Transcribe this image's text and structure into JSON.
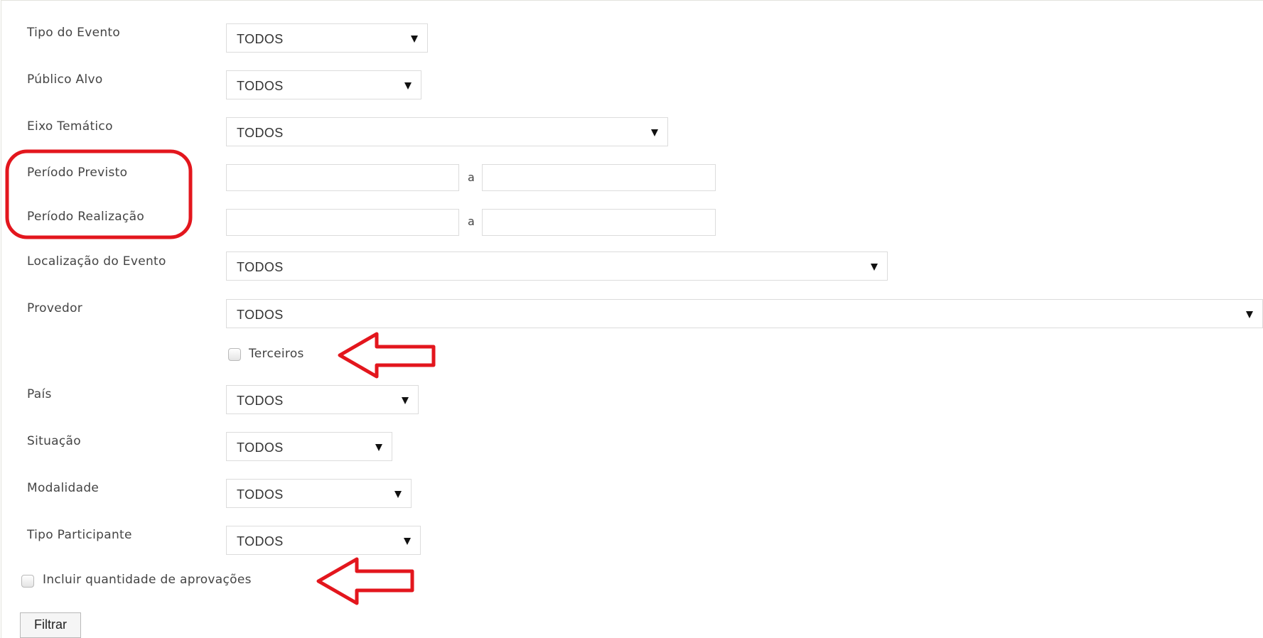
{
  "filters": [
    {
      "id": "tipo-evento",
      "label": "Tipo do Evento",
      "value": "TODOS"
    },
    {
      "id": "publico-alvo",
      "label": "Público Alvo",
      "value": "TODOS"
    },
    {
      "id": "eixo-tematico",
      "label": "Eixo Temático",
      "value": "TODOS"
    },
    {
      "id": "periodo-previsto",
      "label": "Período Previsto",
      "start": "",
      "end": "",
      "separator": "a"
    },
    {
      "id": "periodo-realizacao",
      "label": "Período Realização",
      "start": "",
      "end": "",
      "separator": "a"
    },
    {
      "id": "localizacao",
      "label": "Localização do Evento",
      "value": "TODOS"
    },
    {
      "id": "provedor",
      "label": "Provedor",
      "value": "TODOS"
    },
    {
      "id": "terceiros",
      "label": "Terceiros",
      "checked": false
    },
    {
      "id": "pais",
      "label": "País",
      "value": "TODOS"
    },
    {
      "id": "situacao",
      "label": "Situação",
      "value": "TODOS"
    },
    {
      "id": "modalidade",
      "label": "Modalidade",
      "value": "TODOS"
    },
    {
      "id": "tipo-participante",
      "label": "Tipo Participante",
      "value": "TODOS"
    },
    {
      "id": "incluir-aprovacoes",
      "label": "Incluir quantidade de aprovações",
      "checked": false
    }
  ],
  "actions": {
    "filter_label": "Filtrar"
  },
  "annotations": {
    "color": "#e3161d",
    "highlight_box_target": "Período Previsto / Período Realização",
    "arrow_targets": [
      "Terceiros",
      "Incluir quantidade de aprovações"
    ]
  }
}
